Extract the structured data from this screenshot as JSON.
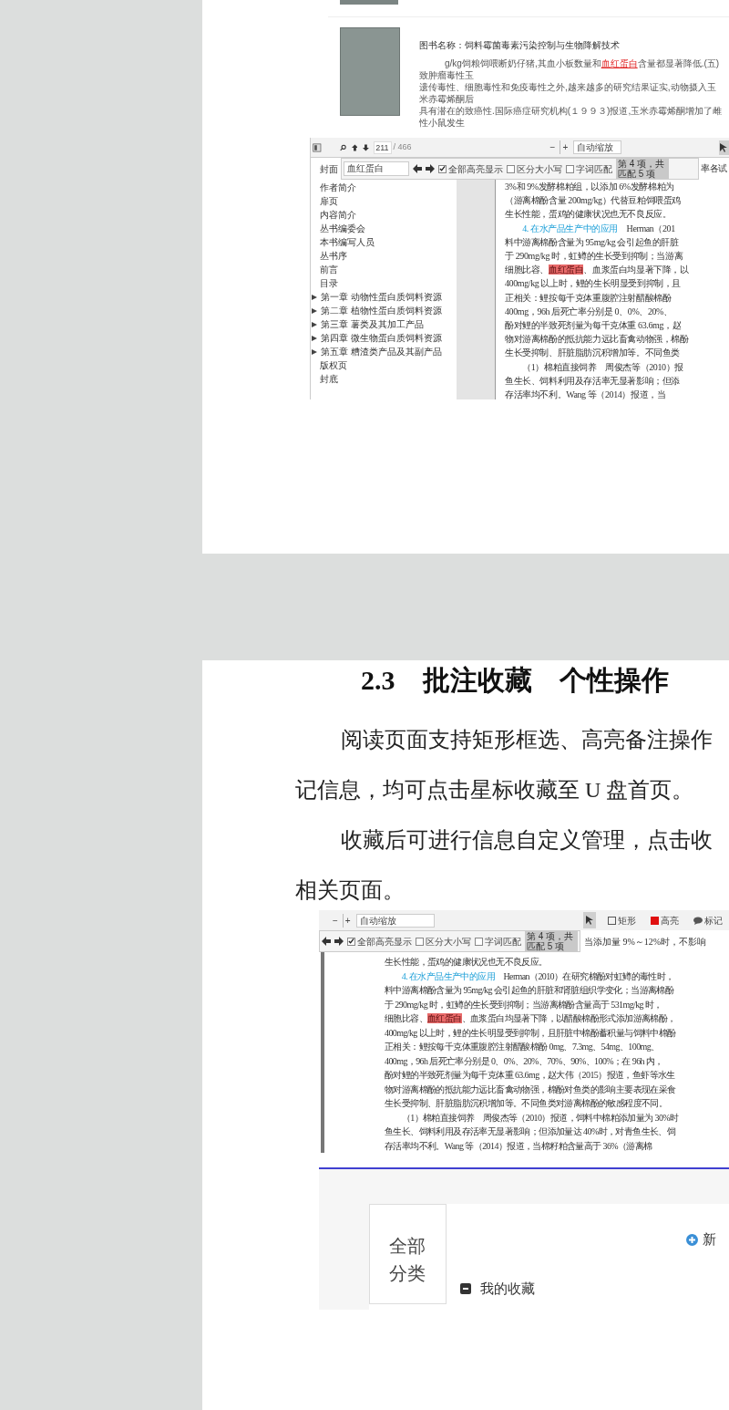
{
  "page_1": {
    "book_result": {
      "title": "图书名称：饲料霉菌毒素污染控制与生物降解技术",
      "snippet_lines": [
        [
          {
            "text": "g/kg饲粮饲喂断奶仔猪,其血小板数量和",
            "kind": "plain"
          },
          {
            "text": "血红蛋白",
            "kind": "highlight"
          },
          {
            "text": "含量都显著降低.(五)致肿瘤毒性玉",
            "kind": "plain"
          }
        ],
        [
          {
            "text": "遗传毒性、细胞毒性和免疫毒性之外,越来越多的研究结果证实,动物摄入玉米赤霉烯酮后",
            "kind": "plain"
          }
        ],
        [
          {
            "text": "具有潜在的致癌性.国际癌症研究机构(１９９３)报道,玉米赤霉烯酮增加了雌性小鼠发生",
            "kind": "plain"
          }
        ]
      ]
    },
    "viewer_screenshot": {
      "toolbar": {
        "page_input": "211",
        "page_count": "/ 466",
        "zoom_out": "−",
        "zoom_in": "+",
        "zoom_select": "自动缩放"
      },
      "find_bar": {
        "query": "血红蛋白",
        "options": [
          {
            "label": "全部高亮显示",
            "checked": true
          },
          {
            "label": "区分大小写",
            "checked": false
          },
          {
            "label": "字词匹配",
            "checked": false
          }
        ],
        "match_status": "第 4 项，共匹配 5 项",
        "uncovered_text": "率各试"
      },
      "outline": [
        {
          "label": "封面",
          "kind": "entry"
        },
        {
          "label": "作者简介",
          "kind": "entry"
        },
        {
          "label": "扉页",
          "kind": "entry"
        },
        {
          "label": "内容简介",
          "kind": "entry"
        },
        {
          "label": "丛书编委会",
          "kind": "entry"
        },
        {
          "label": "本书编写人员",
          "kind": "entry"
        },
        {
          "label": "丛书序",
          "kind": "entry"
        },
        {
          "label": "前言",
          "kind": "entry"
        },
        {
          "label": "目录",
          "kind": "entry"
        },
        {
          "label": "第一章 动物性蛋白质饲料资源",
          "kind": "chapter",
          "expanded": false
        },
        {
          "label": "第二章 植物性蛋白质饲料资源",
          "kind": "chapter",
          "expanded": false
        },
        {
          "label": "第三章 薯类及其加工产品",
          "kind": "chapter",
          "expanded": false
        },
        {
          "label": "第四章 微生物蛋白质饲料资源",
          "kind": "chapter",
          "expanded": false
        },
        {
          "label": "第五章 糟渣类产品及其副产品",
          "kind": "chapter",
          "expanded": false
        },
        {
          "label": "版权页",
          "kind": "entry"
        },
        {
          "label": "封底",
          "kind": "entry"
        }
      ],
      "document_lines": [
        [
          {
            "text": "3%和 9%发酵棉粕组，以添加 6%发酵棉粕为",
            "kind": "plain"
          }
        ],
        [
          {
            "text": "（游离棉酚含量 200mg/kg）代替豆粕饲喂蛋鸡",
            "kind": "plain"
          }
        ],
        [
          {
            "text": "生长性能，蛋鸡的健康状况也无不良反应。",
            "kind": "plain"
          }
        ],
        [
          {
            "text": "　　4. 在水产品生产中的应用",
            "kind": "heading"
          },
          {
            "text": "　Herman（201",
            "kind": "plain"
          }
        ],
        [
          {
            "text": "料中游离棉酚含量为 95mg/kg 会引起鱼的肝脏",
            "kind": "plain"
          }
        ],
        [
          {
            "text": "于 290mg/kg 时，虹鳟的生长受到抑制；当游离",
            "kind": "plain"
          }
        ],
        [
          {
            "text": "细胞比容、",
            "kind": "plain"
          },
          {
            "text": "血红蛋白",
            "kind": "highlight"
          },
          {
            "text": "、血浆蛋白均显著下降，以",
            "kind": "plain"
          }
        ],
        [
          {
            "text": "400mg/kg 以上时，鲤的生长明显受到抑制，且",
            "kind": "plain"
          }
        ],
        [
          {
            "text": "正相关：鲤按每千克体重腹腔注射醋酸棉酚",
            "kind": "plain"
          }
        ],
        [
          {
            "text": "400mg，96h 后死亡率分别是 0、0%、20%、",
            "kind": "plain"
          }
        ],
        [
          {
            "text": "酚对鲤的半致死剂量为每千克体重 63.6mg，赵",
            "kind": "plain"
          }
        ],
        [
          {
            "text": "物对游离棉酚的抵抗能力远比畜禽动物强，棉酚",
            "kind": "plain"
          }
        ],
        [
          {
            "text": "生长受抑制、肝脏脂肪沉积增加等。不同鱼类",
            "kind": "plain"
          }
        ],
        [
          {
            "text": "　　（1）棉粕直接饲养　周俊杰等（2010）报",
            "kind": "plain"
          }
        ],
        [
          {
            "text": "鱼生长、饲料利用及存活率无显著影响；但添",
            "kind": "plain"
          }
        ],
        [
          {
            "text": "存活率均不利。Wang 等（2014）报道，当",
            "kind": "plain"
          }
        ]
      ]
    }
  },
  "page_2": {
    "heading": "2.3　批注收藏　个性操作",
    "paragraphs": [
      {
        "lines": [
          "阅读页面支持矩形框选、高亮备注操作",
          "记信息，均可点击星标收藏至 U 盘首页。"
        ]
      },
      {
        "lines": [
          "收藏后可进行信息自定义管理，点击收",
          "相关页面。"
        ]
      }
    ],
    "viewer_screenshot": {
      "toolbar": {
        "zoom_out": "−",
        "zoom_in": "+",
        "zoom_select": "自动缩放",
        "tools": [
          {
            "kind": "pointer",
            "selected": true
          },
          {
            "label": "矩形",
            "kind": "rectangle",
            "selected": false
          },
          {
            "label": "高亮",
            "kind": "highlight",
            "selected": false
          },
          {
            "label": "标记",
            "kind": "note",
            "selected": false
          }
        ]
      },
      "find_bar": {
        "options": [
          {
            "label": "全部高亮显示",
            "checked": true
          },
          {
            "label": "区分大小写",
            "checked": false
          },
          {
            "label": "字词匹配",
            "checked": false
          }
        ],
        "match_status": "第 4 项，共匹配 5 项",
        "uncovered_text": "当添加量 9%～12%时，不影响"
      },
      "document_lines": [
        [
          {
            "text": "生长性能，蛋鸡的健康状况也无不良反应。",
            "kind": "plain"
          }
        ],
        [
          {
            "text": "　　4. 在水产品生产中的应用",
            "kind": "heading"
          },
          {
            "text": "　Herman（2010）在研究棉酚对虹鳟的毒性时，",
            "kind": "plain"
          }
        ],
        [
          {
            "text": "料中游离棉酚含量为 95mg/kg 会引起鱼的肝脏和肾脏组织学变化；当游离棉酚",
            "kind": "plain"
          }
        ],
        [
          {
            "text": "于 290mg/kg 时，虹鳟的生长受到抑制；当游离棉酚含量高于 531mg/kg 时，",
            "kind": "plain"
          }
        ],
        [
          {
            "text": "细胞比容、",
            "kind": "plain"
          },
          {
            "text": "血红蛋白",
            "kind": "highlight"
          },
          {
            "text": "、血浆蛋白均显著下降，以醋酸棉酚形式添加游离棉酚，",
            "kind": "plain"
          }
        ],
        [
          {
            "text": "400mg/kg 以上时，鲤的生长明显受到抑制，且肝脏中棉酚蓄积量与饲料中棉酚",
            "kind": "plain"
          }
        ],
        [
          {
            "text": "正相关：鲤按每千克体重腹腔注射醋酸棉酚 0mg、7.3mg、54mg、100mg、",
            "kind": "plain"
          }
        ],
        [
          {
            "text": "400mg，96h 后死亡率分别是 0、0%、20%、70%、90%、100%；在 96h 内，",
            "kind": "plain"
          }
        ],
        [
          {
            "text": "酚对鲤的半致死剂量为每千克体重 63.6mg，赵大伟（2015）报道，鱼虾等水生",
            "kind": "plain"
          }
        ],
        [
          {
            "text": "物对游离棉酚的抵抗能力远比畜禽动物强，棉酚对鱼类的影响主要表现在采食",
            "kind": "plain"
          }
        ],
        [
          {
            "text": "生长受抑制、肝脏脂肪沉积增加等。不同鱼类对游离棉酚的敏感程度不同。",
            "kind": "plain"
          }
        ],
        [
          {
            "text": "　　（1）棉粕直接饲养　周俊杰等（2010）报道，饲料中棉粕添加量为 30%时",
            "kind": "plain"
          }
        ],
        [
          {
            "text": "鱼生长、饲料利用及存活率无显著影响；但添加量达 40%时，对青鱼生长、饲",
            "kind": "plain"
          }
        ],
        [
          {
            "text": "存活率均不利。Wang 等（2014）报道，当棉籽粕含量高于 36%（游离棉",
            "kind": "plain"
          }
        ]
      ]
    },
    "favorites_screenshot": {
      "category_panel": "全部分类",
      "folders": [
        {
          "label": "我的收藏",
          "expanded": true
        }
      ],
      "add_button": "新"
    }
  }
}
